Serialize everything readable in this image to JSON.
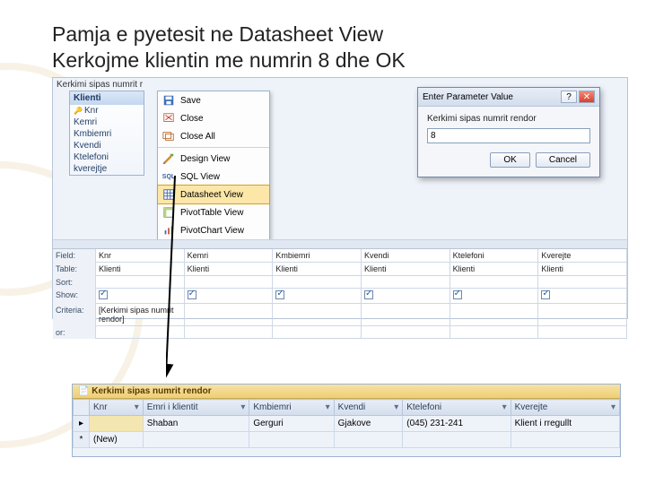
{
  "slide": {
    "title_line1": "Pamja e pyetesit ne Datasheet View",
    "title_line2": "Kerkojme klientin me numrin 8 dhe OK"
  },
  "designer": {
    "tab_label": "Kerkimi sipas numrit r"
  },
  "table_card": {
    "title": "Klienti",
    "fields": [
      "Knr",
      "Kemri",
      "Kmbiemri",
      "Kvendi",
      "Ktelefoni",
      "kverejtje"
    ]
  },
  "context_menu": {
    "items": [
      {
        "label": "Save",
        "icon": "save"
      },
      {
        "label": "Close",
        "icon": "close"
      },
      {
        "label": "Close All",
        "icon": "closeall"
      },
      {
        "label": "Design View",
        "icon": "design"
      },
      {
        "label": "SQL View",
        "icon": "sql"
      },
      {
        "label": "Datasheet View",
        "icon": "datasheet",
        "active": true
      },
      {
        "label": "PivotTable View",
        "icon": "pivottable"
      },
      {
        "label": "PivotChart View",
        "icon": "pivotchart"
      }
    ]
  },
  "param_dialog": {
    "title": "Enter Parameter Value",
    "prompt": "Kerkimi sipas numrit rendor",
    "value": "8",
    "ok": "OK",
    "cancel": "Cancel"
  },
  "field_grid": {
    "row_labels": [
      "Field:",
      "Table:",
      "Sort:",
      "Show:",
      "Criteria:",
      "or:"
    ],
    "columns": [
      {
        "field": "Knr",
        "table": "Klienti",
        "show": true,
        "criteria": "[Kerkimi sipas numrit rendor]"
      },
      {
        "field": "Kemri",
        "table": "Klienti",
        "show": true,
        "criteria": ""
      },
      {
        "field": "Kmbiemri",
        "table": "Klienti",
        "show": true,
        "criteria": ""
      },
      {
        "field": "Kvendi",
        "table": "Klienti",
        "show": true,
        "criteria": ""
      },
      {
        "field": "Ktelefoni",
        "table": "Klienti",
        "show": true,
        "criteria": ""
      },
      {
        "field": "Kverejte",
        "table": "Klienti",
        "show": true,
        "criteria": ""
      }
    ]
  },
  "result": {
    "tab_label": "Kerkimi sipas numrit rendor",
    "headers": [
      "Knr",
      "Emri i klientit",
      "Kmbiemri",
      "Kvendi",
      "Ktelefoni",
      "Kverejte"
    ],
    "row": {
      "knr": "",
      "emri": "Shaban",
      "mbiemri": "Gerguri",
      "vendi": "Gjakove",
      "tel": "(045) 231-241",
      "ver": "Klient i rregullt"
    },
    "new_marker": "(New)"
  }
}
